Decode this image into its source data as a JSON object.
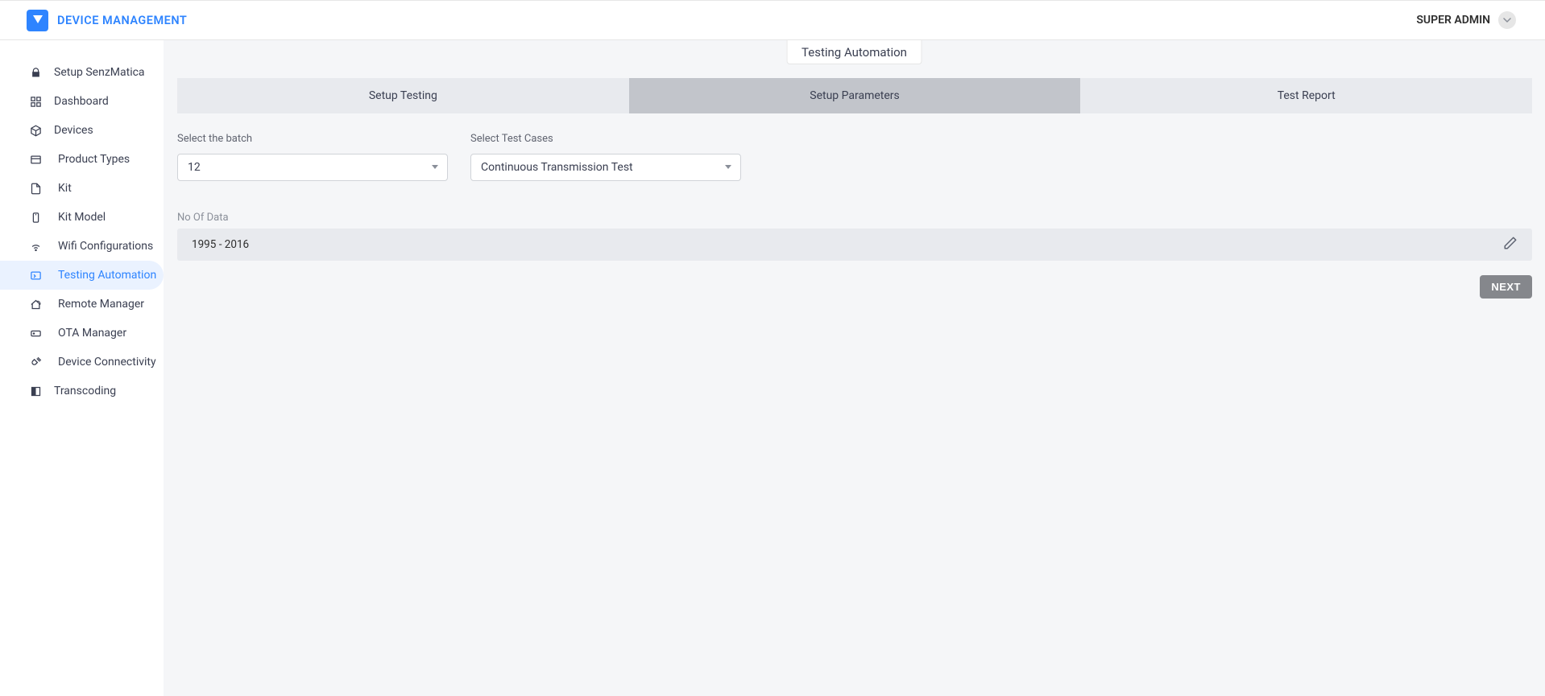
{
  "header": {
    "brand": "DEVICE MANAGEMENT",
    "user": "SUPER ADMIN"
  },
  "sidebar": {
    "items": [
      {
        "label": "Setup SenzMatica",
        "icon": "lock-icon"
      },
      {
        "label": "Dashboard",
        "icon": "dashboard-icon"
      },
      {
        "label": "Devices",
        "icon": "cube-icon"
      },
      {
        "label": "Product Types",
        "icon": "box-icon",
        "indent": true
      },
      {
        "label": "Kit",
        "icon": "file-icon",
        "indent": true
      },
      {
        "label": "Kit Model",
        "icon": "phone-icon",
        "indent": true
      },
      {
        "label": "Wifi Configurations",
        "icon": "wifi-icon",
        "indent": true
      },
      {
        "label": "Testing Automation",
        "icon": "terminal-icon",
        "indent": true,
        "active": true
      },
      {
        "label": "Remote Manager",
        "icon": "home-signal-icon",
        "indent": true
      },
      {
        "label": "OTA Manager",
        "icon": "card-icon",
        "indent": true
      },
      {
        "label": "Device Connectivity",
        "icon": "plug-icon",
        "indent": true
      },
      {
        "label": "Transcoding",
        "icon": "column-icon"
      }
    ]
  },
  "content": {
    "chip": "Testing Automation",
    "tabs": [
      {
        "label": "Setup Testing"
      },
      {
        "label": "Setup Parameters",
        "selected": true
      },
      {
        "label": "Test Report"
      }
    ],
    "form": {
      "batch_label": "Select the batch",
      "batch_value": "12",
      "tests_label": "Select Test Cases",
      "tests_value": "Continuous Transmission Test",
      "data_label": "No Of Data",
      "data_value": "1995 - 2016",
      "next_label": "NEXT"
    }
  }
}
